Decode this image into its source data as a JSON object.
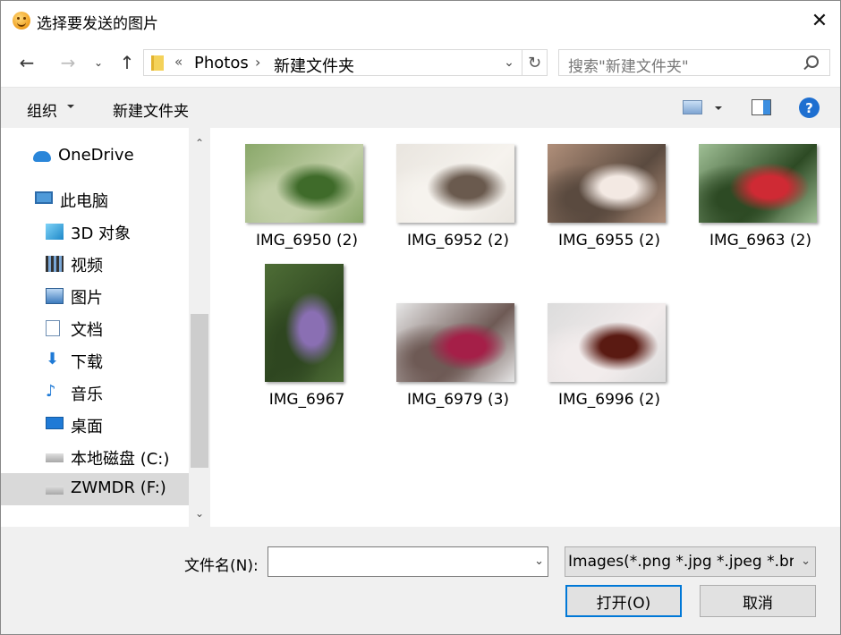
{
  "window": {
    "title": "选择要发送的图片",
    "close_glyph": "✕"
  },
  "nav": {
    "back_glyph": "←",
    "forward_glyph": "→",
    "recent_glyph": "⌄",
    "up_glyph": "↑",
    "breadcrumb_overflow": "«",
    "breadcrumb": [
      "Photos",
      "新建文件夹"
    ],
    "breadcrumb_sep": "›",
    "dropdown_glyph": "⌄",
    "refresh_glyph": "↻",
    "search_placeholder": "搜索\"新建文件夹\""
  },
  "toolbar": {
    "organize": "组织",
    "new_folder": "新建文件夹",
    "help_glyph": "?"
  },
  "sidebar": {
    "items": [
      {
        "label": "OneDrive",
        "icon": "onedrive-icon"
      },
      {
        "label": "此电脑",
        "icon": "pc-icon"
      },
      {
        "label": "3D 对象",
        "icon": "3d-objects-icon"
      },
      {
        "label": "视频",
        "icon": "video-icon"
      },
      {
        "label": "图片",
        "icon": "pictures-icon"
      },
      {
        "label": "文档",
        "icon": "documents-icon"
      },
      {
        "label": "下载",
        "icon": "download-icon"
      },
      {
        "label": "音乐",
        "icon": "music-icon"
      },
      {
        "label": "桌面",
        "icon": "desktop-icon"
      },
      {
        "label": "本地磁盘 (C:)",
        "icon": "drive-c-icon"
      },
      {
        "label": "ZWMDR (F:)",
        "icon": "drive-f-icon",
        "selected": true
      }
    ],
    "scroll_up_glyph": "⌃",
    "scroll_down_glyph": "⌄"
  },
  "files": [
    {
      "name": "IMG_6950 (2)",
      "colors": [
        "#8aa86a",
        "#3f6b2a",
        "#c2cfa8"
      ]
    },
    {
      "name": "IMG_6952 (2)",
      "colors": [
        "#e9e5df",
        "#6a5a4e",
        "#f6f3ee"
      ]
    },
    {
      "name": "IMG_6955 (2)",
      "colors": [
        "#b08f7a",
        "#f3e9e3",
        "#5a4a3f"
      ]
    },
    {
      "name": "IMG_6963 (2)",
      "colors": [
        "#9fbf95",
        "#cf2a34",
        "#2d4a24"
      ]
    },
    {
      "name": "IMG_6967",
      "colors": [
        "#4e6d36",
        "#8a6fb3",
        "#2e4620"
      ]
    },
    {
      "name": "IMG_6979 (3)",
      "colors": [
        "#e6e6e6",
        "#a51f48",
        "#6e5a55"
      ]
    },
    {
      "name": "IMG_6996 (2)",
      "colors": [
        "#dcdcdc",
        "#5a1a12",
        "#f2ecec"
      ]
    }
  ],
  "footer": {
    "filename_label": "文件名(N):",
    "filename_value": "",
    "filter_value": "Images(*.png *.jpg *.jpeg *.bmp)",
    "dropdown_glyph": "⌄",
    "open_button": "打开(O)",
    "cancel_button": "取消"
  }
}
